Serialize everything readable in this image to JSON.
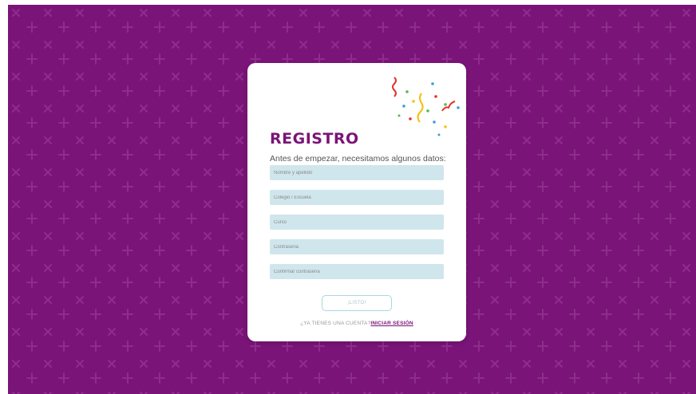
{
  "background": {
    "color": "#7a1478",
    "pattern": "cross-and-plus"
  },
  "card": {
    "title": "REGISTRO",
    "subtitle": "Antes de empezar, necesitamos algunos datos:",
    "fields": [
      {
        "placeholder": "Nombre y apellido",
        "value": ""
      },
      {
        "placeholder": "Colegio / Escuela",
        "value": ""
      },
      {
        "placeholder": "Curso",
        "value": ""
      },
      {
        "placeholder": "Contraseña",
        "value": ""
      },
      {
        "placeholder": "Confirmar contraseña",
        "value": ""
      }
    ],
    "submit_label": "¡LISTO!",
    "login_prompt": "¿YA TIENES UNA CUENTA?",
    "login_link": "INICIAR SESIÓN",
    "decoration": "confetti-icon"
  },
  "colors": {
    "accent": "#7a1478",
    "field_bg": "#cfe6ec",
    "button_border": "#a8d8e0"
  }
}
